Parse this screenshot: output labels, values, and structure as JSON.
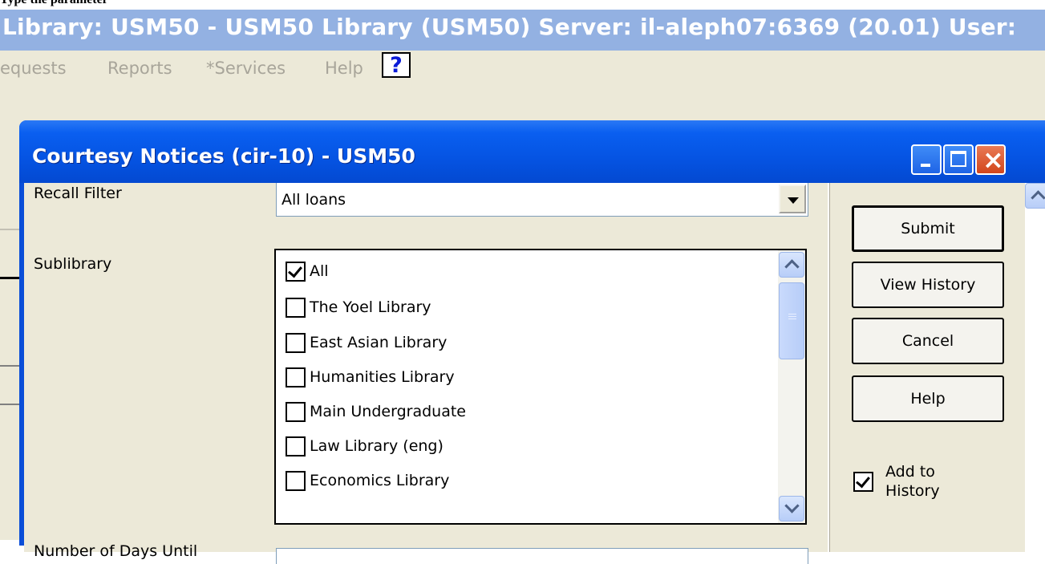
{
  "top_caption": "Type the parameter",
  "app": {
    "title": "Library:  USM50 - USM50 Library (USM50)  Server:  il-aleph07:6369 (20.01)  User:",
    "menu": [
      "equests",
      "Reports",
      "*Services",
      "Help"
    ],
    "help_icon": "?"
  },
  "dialog": {
    "title": "Courtesy Notices (cir-10) - USM50",
    "recall_filter": {
      "label": "Recall Filter",
      "value": "All loans"
    },
    "sublibrary": {
      "label": "Sublibrary",
      "items": [
        {
          "label": "All",
          "checked": true
        },
        {
          "label": "The Yoel Library",
          "checked": false
        },
        {
          "label": "East Asian Library",
          "checked": false
        },
        {
          "label": "Humanities Library",
          "checked": false
        },
        {
          "label": "Main Undergraduate",
          "checked": false
        },
        {
          "label": "Law Library (eng)",
          "checked": false
        },
        {
          "label": "Economics Library",
          "checked": false
        }
      ]
    },
    "days_until_label": "Number of Days Until",
    "buttons": {
      "submit": "Submit",
      "view_history": "View History",
      "cancel": "Cancel",
      "help": "Help"
    },
    "add_to_history": {
      "label_line1": "Add to",
      "label_line2": "History",
      "checked": true
    }
  }
}
